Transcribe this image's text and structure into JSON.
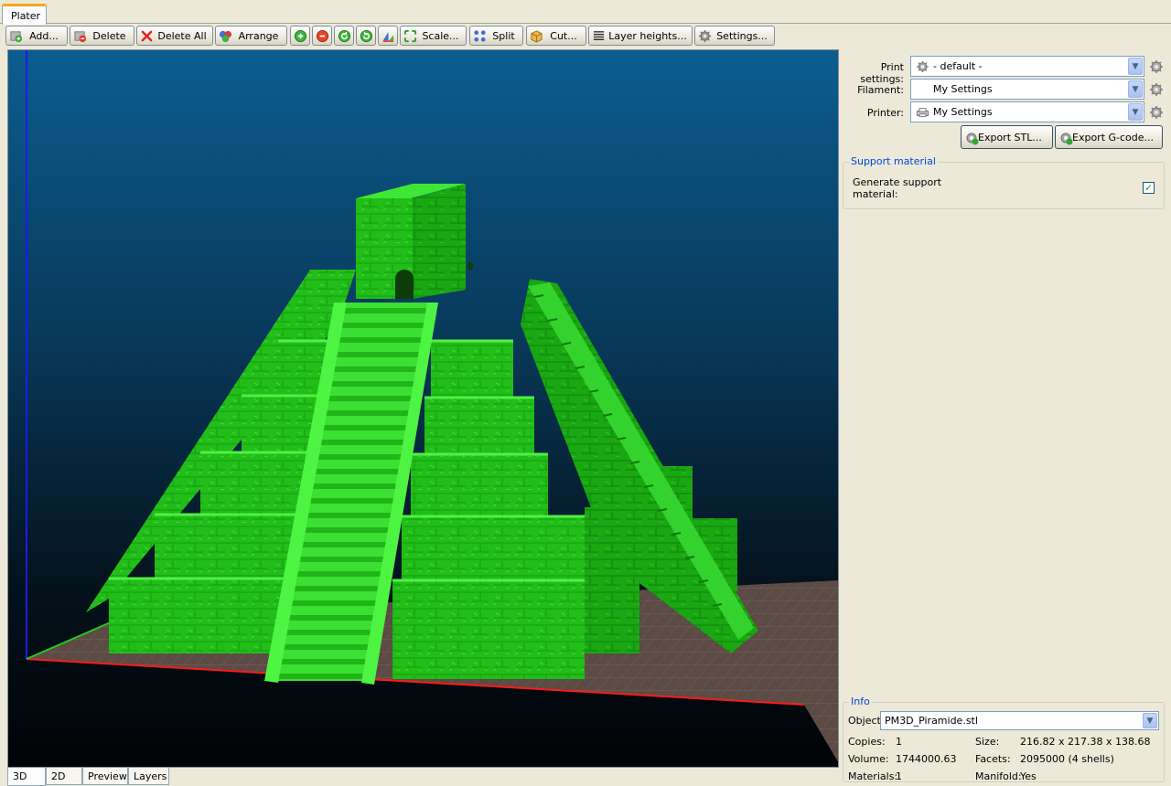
{
  "tabs": {
    "plater": "Plater"
  },
  "toolbar": {
    "add": "Add...",
    "delete": "Delete",
    "delete_all": "Delete All",
    "arrange": "Arrange",
    "scale": "Scale...",
    "split": "Split",
    "cut": "Cut...",
    "layer_heights": "Layer heights...",
    "settings": "Settings..."
  },
  "view_tabs": [
    "3D",
    "2D",
    "Preview",
    "Layers"
  ],
  "settings": {
    "print_label": "Print settings:",
    "print_value": "- default -",
    "filament_label": "Filament:",
    "filament_value": "My Settings",
    "printer_label": "Printer:",
    "printer_value": "My Settings",
    "export_stl": "Export STL...",
    "export_gcode": "Export G-code..."
  },
  "support": {
    "title": "Support material",
    "generate_label_line1": "Generate support",
    "generate_label_line2": "material:",
    "checked": true,
    "check_mark": "✓"
  },
  "info": {
    "title": "Info",
    "object_label": "Object:",
    "object_value": "PM3D_Piramide.stl",
    "copies_label": "Copies:",
    "copies_value": "1",
    "size_label": "Size:",
    "size_value": "216.82 x 217.38 x 138.68",
    "volume_label": "Volume:",
    "volume_value": "1744000.63",
    "facets_label": "Facets:",
    "facets_value": "2095000 (4 shells)",
    "materials_label": "Materials:",
    "materials_value": "1",
    "manifold_label": "Manifold:",
    "manifold_value": "Yes"
  },
  "colors": {
    "model_green": "#22c21a",
    "bed": "#5c4a44",
    "axis_x": "#ff1a1a",
    "axis_y": "#22cc22",
    "axis_z": "#1a1aff",
    "accent_blue": "#0046d5"
  }
}
